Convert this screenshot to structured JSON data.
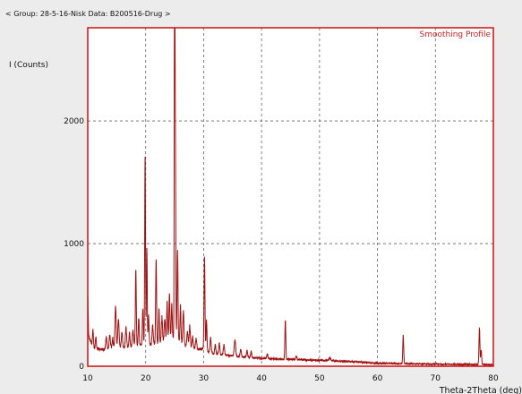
{
  "header": {
    "group_text": "< Group: 28-5-16-Nisk   Data: B200516-Drug >"
  },
  "chart_data": {
    "type": "line",
    "title": "Smoothing Profile",
    "ylabel": "I (Counts)",
    "xlabel": "Theta-2Theta (deg)",
    "xlim": [
      10,
      80
    ],
    "ylim": [
      0,
      2760
    ],
    "xticks": [
      10,
      20,
      30,
      40,
      50,
      60,
      70,
      80
    ],
    "yticks": [
      0,
      1000,
      2000
    ],
    "grid": true,
    "colors": {
      "line": "#a01010",
      "frame": "#cc1111",
      "grid": "#666666"
    },
    "baseline": [
      [
        10,
        600
      ],
      [
        10.15,
        250
      ],
      [
        10.5,
        200
      ],
      [
        11,
        150
      ],
      [
        12,
        140
      ],
      [
        13,
        135
      ],
      [
        14,
        150
      ],
      [
        15,
        170
      ],
      [
        16,
        150
      ],
      [
        17,
        160
      ],
      [
        18,
        170
      ],
      [
        19,
        170
      ],
      [
        20,
        180
      ],
      [
        21,
        175
      ],
      [
        22,
        185
      ],
      [
        23,
        200
      ],
      [
        24,
        230
      ],
      [
        25,
        230
      ],
      [
        26,
        200
      ],
      [
        27,
        160
      ],
      [
        28,
        150
      ],
      [
        29,
        140
      ],
      [
        30,
        140
      ],
      [
        31,
        110
      ],
      [
        32,
        100
      ],
      [
        33,
        95
      ],
      [
        34,
        90
      ],
      [
        35,
        85
      ],
      [
        36,
        80
      ],
      [
        37,
        75
      ],
      [
        38,
        70
      ],
      [
        39,
        70
      ],
      [
        40,
        65
      ],
      [
        42,
        60
      ],
      [
        44,
        55
      ],
      [
        46,
        55
      ],
      [
        48,
        50
      ],
      [
        50,
        50
      ],
      [
        52,
        45
      ],
      [
        55,
        40
      ],
      [
        58,
        30
      ],
      [
        60,
        25
      ],
      [
        63,
        22
      ],
      [
        66,
        20
      ],
      [
        70,
        18
      ],
      [
        75,
        15
      ],
      [
        80,
        12
      ]
    ],
    "peaks": [
      [
        10.9,
        140,
        0.08
      ],
      [
        11.4,
        90,
        0.08
      ],
      [
        13.2,
        100,
        0.1
      ],
      [
        13.8,
        110,
        0.1
      ],
      [
        14.3,
        80,
        0.08
      ],
      [
        14.8,
        330,
        0.1
      ],
      [
        15.3,
        220,
        0.1
      ],
      [
        15.9,
        120,
        0.1
      ],
      [
        16.6,
        160,
        0.1
      ],
      [
        17.2,
        110,
        0.08
      ],
      [
        17.8,
        130,
        0.1
      ],
      [
        18.3,
        620,
        0.08
      ],
      [
        18.8,
        230,
        0.08
      ],
      [
        19.5,
        300,
        0.08
      ],
      [
        19.9,
        1540,
        0.07
      ],
      [
        20.2,
        770,
        0.07
      ],
      [
        20.5,
        230,
        0.08
      ],
      [
        21.2,
        150,
        0.1
      ],
      [
        21.8,
        690,
        0.08
      ],
      [
        22.3,
        270,
        0.08
      ],
      [
        22.8,
        200,
        0.1
      ],
      [
        23.3,
        170,
        0.1
      ],
      [
        23.7,
        300,
        0.08
      ],
      [
        24.1,
        380,
        0.08
      ],
      [
        24.5,
        270,
        0.08
      ],
      [
        24.98,
        2530,
        0.06
      ],
      [
        25.1,
        1700,
        0.08
      ],
      [
        25.5,
        720,
        0.08
      ],
      [
        26.0,
        300,
        0.08
      ],
      [
        26.5,
        260,
        0.1
      ],
      [
        27.2,
        130,
        0.1
      ],
      [
        27.6,
        180,
        0.1
      ],
      [
        28.1,
        90,
        0.1
      ],
      [
        28.7,
        80,
        0.1
      ],
      [
        30.15,
        750,
        0.08
      ],
      [
        30.5,
        250,
        0.08
      ],
      [
        31.2,
        120,
        0.1
      ],
      [
        32.0,
        70,
        0.1
      ],
      [
        32.7,
        90,
        0.1
      ],
      [
        33.5,
        80,
        0.1
      ],
      [
        35.4,
        130,
        0.12
      ],
      [
        36.4,
        60,
        0.1
      ],
      [
        37.5,
        50,
        0.1
      ],
      [
        38.2,
        50,
        0.1
      ],
      [
        41.0,
        35,
        0.1
      ],
      [
        44.1,
        310,
        0.08
      ],
      [
        46.0,
        25,
        0.1
      ],
      [
        51.8,
        20,
        0.15
      ],
      [
        64.45,
        230,
        0.08
      ],
      [
        77.6,
        290,
        0.08
      ],
      [
        77.9,
        120,
        0.08
      ]
    ]
  }
}
